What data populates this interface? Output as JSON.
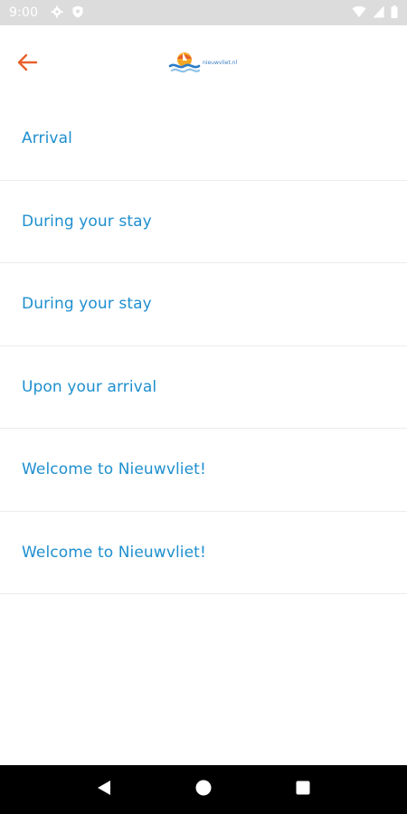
{
  "status_bar": {
    "time": "9:00",
    "icons": [
      "gear-icon",
      "shield-icon",
      "wifi-icon",
      "signal-icon",
      "battery-icon"
    ]
  },
  "app_bar": {
    "back_icon": "arrow-left-icon",
    "logo_text": "nieuwvliet.nl",
    "accent_color": "#e8602c"
  },
  "menu": {
    "items": [
      {
        "label": "Arrival"
      },
      {
        "label": "During your stay"
      },
      {
        "label": "During your stay"
      },
      {
        "label": "Upon your arrival"
      },
      {
        "label": "Welcome to Nieuwvliet!"
      },
      {
        "label": "Welcome to Nieuwvliet!"
      }
    ],
    "label_color": "#1e8fcf"
  },
  "nav_bar": {
    "icons": [
      "back-triangle-icon",
      "home-circle-icon",
      "recents-square-icon"
    ]
  }
}
